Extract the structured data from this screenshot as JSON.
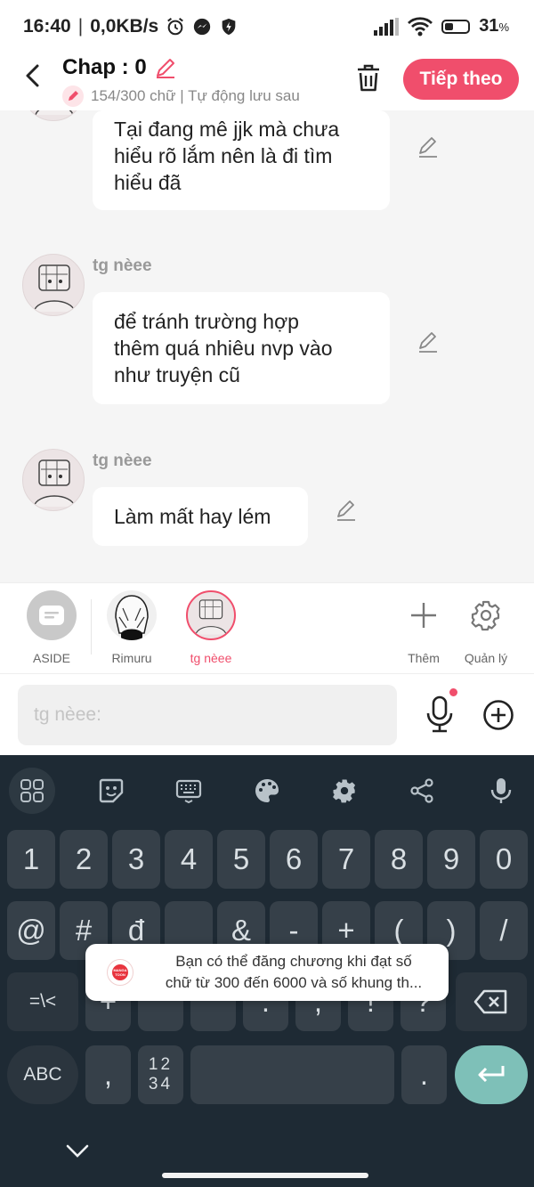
{
  "status_bar": {
    "time": "16:40",
    "separator": "|",
    "speed": "0,0KB/s",
    "battery": "31",
    "battery_unit": "%",
    "battery_level": 0.31
  },
  "header": {
    "title": "Chap : 0",
    "subtitle": "154/300 chữ | Tự động lưu sau",
    "next_label": "Tiếp theo"
  },
  "chat": {
    "messages": [
      {
        "sender": "",
        "text_lines": [
          "Tại đang mê jjk mà chưa",
          "hiểu rõ lắm nên là đi tìm",
          "hiểu đã"
        ]
      },
      {
        "sender": "tg nèee",
        "text_lines": [
          "để tránh trường hợp",
          "thêm quá nhiêu nvp vào",
          "như truyện cũ"
        ]
      },
      {
        "sender": "tg nèee",
        "text_lines": [
          "Làm mất hay lém"
        ]
      }
    ]
  },
  "characters": {
    "items": [
      {
        "label": "ASIDE"
      },
      {
        "label": "Rimuru"
      },
      {
        "label": "tg nèee",
        "selected": true
      }
    ],
    "add_label": "Thêm",
    "manage_label": "Quản lý",
    "accent_color": "#f04e6c"
  },
  "input": {
    "placeholder": "tg nèee:"
  },
  "keyboard": {
    "toolbar_icons": [
      "grid-icon",
      "sticker-icon",
      "keyboard-icon",
      "palette-icon",
      "gear-icon",
      "share-icon",
      "mic-icon"
    ],
    "row1": [
      "1",
      "2",
      "3",
      "4",
      "5",
      "6",
      "7",
      "8",
      "9",
      "0"
    ],
    "row2": [
      "@",
      "#",
      "đ",
      "",
      "&",
      "-",
      "+",
      "(",
      ")",
      "/"
    ],
    "row3": [
      "=\\<",
      "+",
      "",
      "",
      ".",
      ",",
      "!",
      "?"
    ],
    "abc": "ABC",
    "comma": ",",
    "numpad_top": "12",
    "numpad_bottom": "34",
    "period": "."
  },
  "toast": {
    "line1": "Bạn có thể đăng chương khi đạt số",
    "line2": "chữ từ 300 đến 6000 và số khung th...",
    "logo_text": "MANGA TOON"
  }
}
